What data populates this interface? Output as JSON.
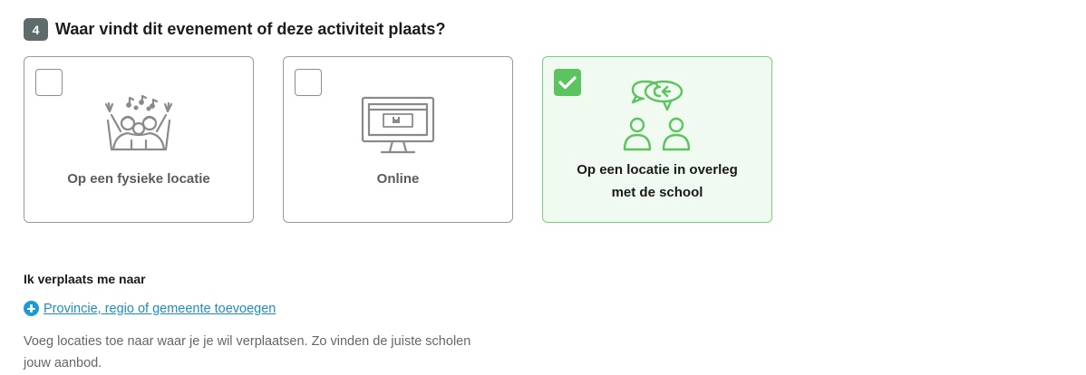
{
  "question": {
    "step_number": "4",
    "title": "Waar vindt dit evenement of deze activiteit plaats?"
  },
  "options": [
    {
      "label": "Op een fysieke locatie",
      "icon": "celebration-icon",
      "selected": false
    },
    {
      "label": "Online",
      "icon": "monitor-icon",
      "selected": false
    },
    {
      "label_line1": "Op een locatie in overleg",
      "label_line2": "met de school",
      "icon": "conversation-icon",
      "selected": true
    }
  ],
  "colors": {
    "selected_border": "#7dcf7f",
    "selected_background": "#f1faf1",
    "check_green": "#5cc45f",
    "link_blue": "#1a8fc8",
    "badge_gray": "#5f6b6b"
  },
  "travel": {
    "title": "Ik verplaats me naar",
    "add_link": "Provincie, regio of gemeente toevoegen",
    "help_text": "Voeg locaties toe naar waar je je wil verplaatsen. Zo vinden de juiste scholen jouw aanbod."
  }
}
